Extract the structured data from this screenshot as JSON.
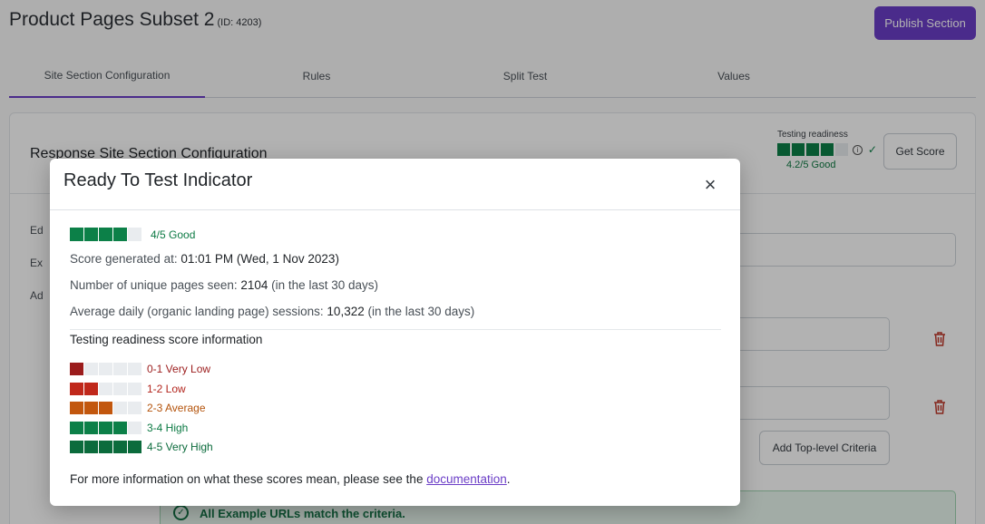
{
  "header": {
    "title": "Product Pages Subset 2",
    "id_label": "(ID: 4203)",
    "publish_label": "Publish Section"
  },
  "tabs": [
    {
      "label": "Site Section Configuration",
      "active": true
    },
    {
      "label": "Rules",
      "active": false
    },
    {
      "label": "Split Test",
      "active": false
    },
    {
      "label": "Values",
      "active": false
    }
  ],
  "panel": {
    "heading": "Response Site Section Configuration",
    "readiness_label": "Testing readiness",
    "readiness_score": "4.2/5 Good",
    "readiness_level": 4,
    "get_score_label": "Get Score",
    "side_items": [
      "Ed",
      "Ex",
      "Ad"
    ],
    "add_criteria_label": "Add Top-level Criteria",
    "success_message": "All Example URLs match the criteria."
  },
  "modal": {
    "title": "Ready To Test Indicator",
    "close_label": "×",
    "score_level": 4,
    "score_text": "4/5 Good",
    "generated_label": "Score generated at: ",
    "generated_value": "01:01 PM (Wed, 1 Nov 2023)",
    "pages_label": "Number of unique pages seen: ",
    "pages_value": "2104",
    "pages_suffix": " (in the last 30 days)",
    "sessions_label": "Average daily (organic landing page) sessions: ",
    "sessions_value": "10,322",
    "sessions_suffix": " (in the last 30 days)",
    "info_title": "Testing readiness score information",
    "legend": [
      {
        "label": "0-1 Very Low",
        "filled": 1,
        "color": "#9b1c1c",
        "text_color": "#9b1c1c"
      },
      {
        "label": "1-2 Low",
        "filled": 2,
        "color": "#c0281b",
        "text_color": "#b3261e"
      },
      {
        "label": "2-3 Average",
        "filled": 3,
        "color": "#c2570e",
        "text_color": "#b4530b"
      },
      {
        "label": "3-4 High",
        "filled": 4,
        "color": "#0c8048",
        "text_color": "#0c7a44"
      },
      {
        "label": "4-5 Very High",
        "filled": 5,
        "color": "#0b6b3c",
        "text_color": "#0b6b3c"
      }
    ],
    "footer_text": "For more information on what these scores mean, please see the ",
    "footer_link": "documentation",
    "footer_end": "."
  },
  "colors": {
    "accent": "#6b3ec7",
    "good": "#0c8048",
    "empty_segment": "#e9ecef"
  }
}
